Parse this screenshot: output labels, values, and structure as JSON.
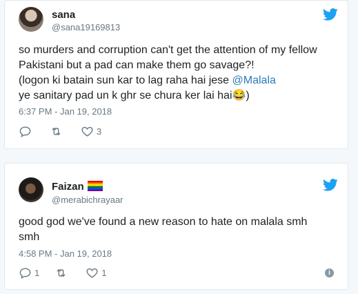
{
  "tweets": [
    {
      "name": "sana",
      "handle": "@sana19169813",
      "text_lines": [
        "so murders and corruption can't get the attention of my fellow",
        "Pakistani but a pad can make them go savage?!",
        "(logon ki batain sun kar to lag raha hai jese ",
        "ye sanitary pad un k ghr se chura ker lai hai😂)"
      ],
      "mention": "@Malala",
      "timestamp": "6:37 PM - Jan 19, 2018",
      "reply_count": "",
      "retweet_count": "",
      "like_count": "3"
    },
    {
      "name": "Faizan",
      "handle": "@merabichrayaar",
      "text_lines": [
        "good god we've found a new reason to hate on malala smh",
        "smh"
      ],
      "timestamp": "4:58 PM - Jan 19, 2018",
      "reply_count": "1",
      "retweet_count": "",
      "like_count": "1",
      "info_label": "i"
    }
  ],
  "colors": {
    "twitter_blue": "#1da1f2",
    "mention": "#2b7bb9",
    "text": "#1c2022",
    "muted": "#697882"
  },
  "icons": [
    "twitter-bird-icon",
    "reply-icon",
    "retweet-icon",
    "like-heart-icon",
    "info-icon",
    "rainbow-flag-icon"
  ]
}
